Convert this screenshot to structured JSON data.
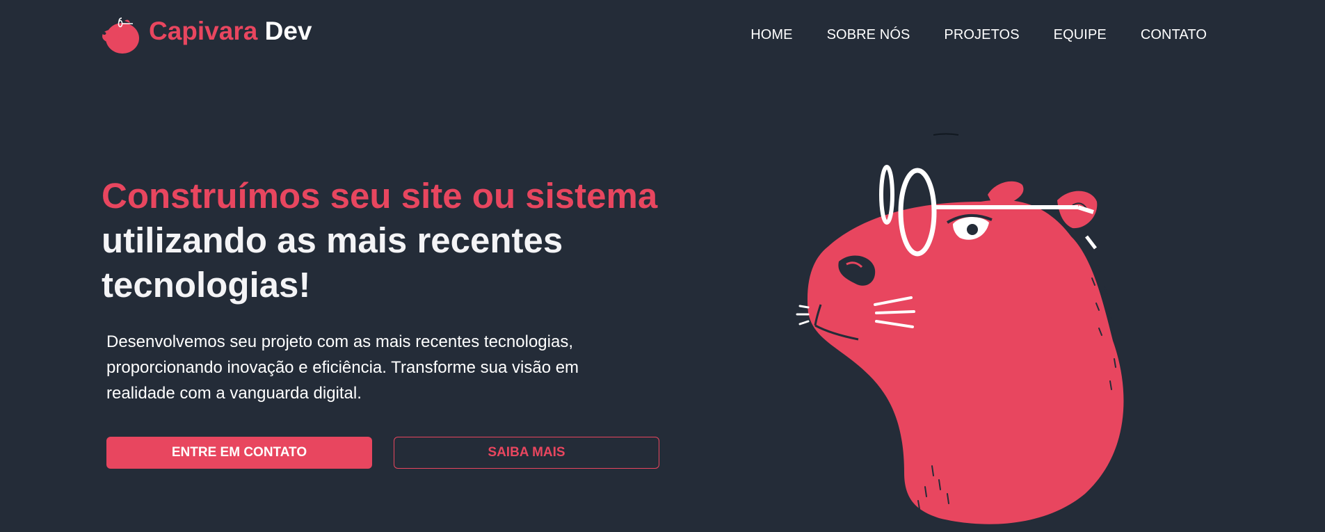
{
  "brand": {
    "name_accent": "Capivara",
    "name_rest": "Dev",
    "logo_icon": "capybara-logo-icon",
    "accent_color": "#e8465f",
    "background_color": "#242c38"
  },
  "nav": {
    "items": [
      {
        "label": "HOME"
      },
      {
        "label": "SOBRE NÓS"
      },
      {
        "label": "PROJETOS"
      },
      {
        "label": "EQUIPE"
      },
      {
        "label": "CONTATO"
      }
    ]
  },
  "hero": {
    "title_accent": "Construímos seu site ou sistema",
    "title_rest": "utilizando as mais recentes tecnologias!",
    "description": "Desenvolvemos seu projeto com as mais recentes tecnologias, proporcionando inovação e eficiência. Transforme sua visão em realidade com a vanguarda digital.",
    "primary_button": "ENTRE EM CONTATO",
    "secondary_button": "SAIBA MAIS",
    "illustration_icon": "capybara-glasses-illustration"
  }
}
